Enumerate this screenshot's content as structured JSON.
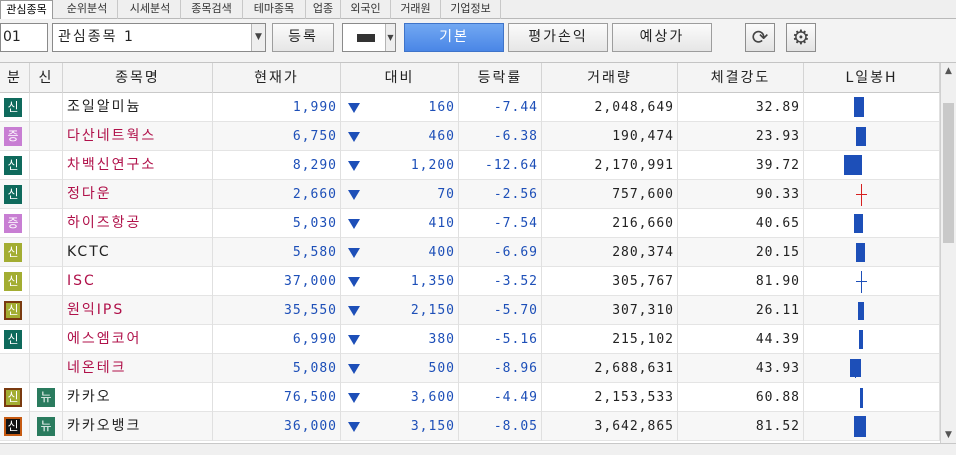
{
  "tabs": [
    "관심종목",
    "순위분석",
    "시세분석",
    "종목검색",
    "테마종목",
    "업종",
    "외국인",
    "거래원",
    "기업정보"
  ],
  "toolbar": {
    "code": "01",
    "group": "관심종목 1",
    "register": "등록",
    "view_basic": "기본",
    "view_pnl": "평가손익",
    "view_deposit": "예상가"
  },
  "columns": [
    "분",
    "신",
    "종목명",
    "현재가",
    "대비",
    "등락률",
    "거래량",
    "체결강도",
    "L일봉H"
  ],
  "colors": {
    "accent": "#4a86e6",
    "down": "#1d4fb8",
    "highlight_name": "#b0114a"
  },
  "rows": [
    {
      "bun": "신",
      "bun_style": "teal",
      "sin": "",
      "name": "조일알미늄",
      "name_color": "dark",
      "price": "1,990",
      "diff": "160",
      "rate": "-7.44",
      "volume": "2,048,649",
      "strength": "32.89"
    },
    {
      "bun": "증",
      "bun_style": "purple",
      "sin": "",
      "name": "다산네트웍스",
      "name_color": "red",
      "price": "6,750",
      "diff": "460",
      "rate": "-6.38",
      "volume": "190,474",
      "strength": "23.93"
    },
    {
      "bun": "신",
      "bun_style": "teal",
      "sin": "",
      "name": "차백신연구소",
      "name_color": "red",
      "price": "8,290",
      "diff": "1,200",
      "rate": "-12.64",
      "volume": "2,170,991",
      "strength": "39.72"
    },
    {
      "bun": "신",
      "bun_style": "teal",
      "sin": "",
      "name": "정다운",
      "name_color": "red",
      "price": "2,660",
      "diff": "70",
      "rate": "-2.56",
      "volume": "757,600",
      "strength": "90.33"
    },
    {
      "bun": "증",
      "bun_style": "purple",
      "sin": "",
      "name": "하이즈항공",
      "name_color": "red",
      "price": "5,030",
      "diff": "410",
      "rate": "-7.54",
      "volume": "216,660",
      "strength": "40.65"
    },
    {
      "bun": "신",
      "bun_style": "olive",
      "sin": "",
      "name": "KCTC",
      "name_color": "dark",
      "price": "5,580",
      "diff": "400",
      "rate": "-6.69",
      "volume": "280,374",
      "strength": "20.15"
    },
    {
      "bun": "신",
      "bun_style": "olive",
      "sin": "",
      "name": "ISC",
      "name_color": "red",
      "price": "37,000",
      "diff": "1,350",
      "rate": "-3.52",
      "volume": "305,767",
      "strength": "81.90"
    },
    {
      "bun": "신",
      "bun_style": "olivebox",
      "sin": "",
      "name": "원익IPS",
      "name_color": "red",
      "price": "35,550",
      "diff": "2,150",
      "rate": "-5.70",
      "volume": "307,310",
      "strength": "26.11"
    },
    {
      "bun": "신",
      "bun_style": "teal",
      "sin": "",
      "name": "에스엠코어",
      "name_color": "red",
      "price": "6,990",
      "diff": "380",
      "rate": "-5.16",
      "volume": "215,102",
      "strength": "44.39"
    },
    {
      "bun": "",
      "bun_style": "",
      "sin": "",
      "name": "네온테크",
      "name_color": "red",
      "price": "5,080",
      "diff": "500",
      "rate": "-8.96",
      "volume": "2,688,631",
      "strength": "43.93"
    },
    {
      "bun": "신",
      "bun_style": "olivebox",
      "sin": "뉴",
      "name": "카카오",
      "name_color": "dark",
      "price": "76,500",
      "diff": "3,600",
      "rate": "-4.49",
      "volume": "2,153,533",
      "strength": "60.88"
    },
    {
      "bun": "신",
      "bun_style": "black",
      "sin": "뉴",
      "name": "카카오뱅크",
      "name_color": "dark",
      "price": "36,000",
      "diff": "3,150",
      "rate": "-8.05",
      "volume": "3,642,865",
      "strength": "81.52"
    }
  ]
}
